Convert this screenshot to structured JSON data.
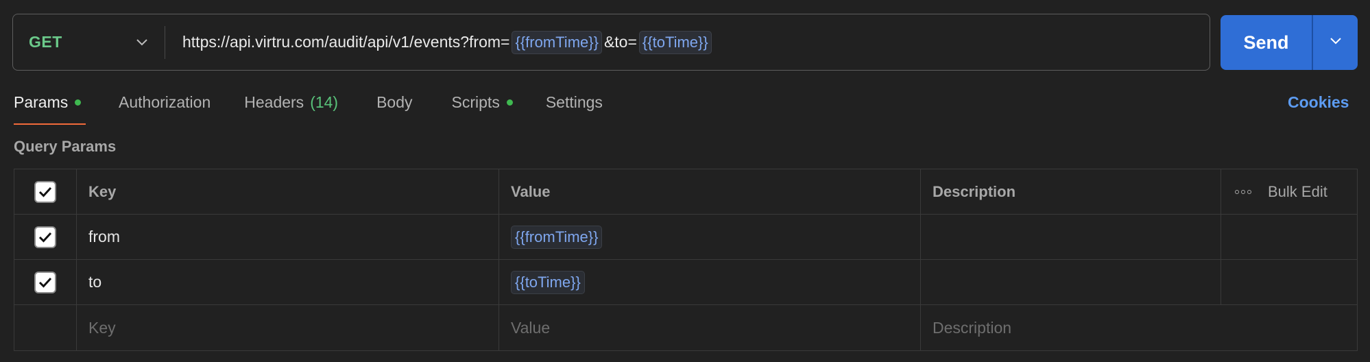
{
  "request": {
    "method": "GET",
    "url_prefix": "https://api.virtru.com/audit/api/v1/events?from=",
    "url_var_from": "{{fromTime}}",
    "url_mid": "&to=",
    "url_var_to": "{{toTime}}"
  },
  "send": {
    "label": "Send"
  },
  "tabs": [
    {
      "label": "Params",
      "active": true,
      "dot": true
    },
    {
      "label": "Authorization"
    },
    {
      "label": "Headers",
      "count": "(14)"
    },
    {
      "label": "Body"
    },
    {
      "label": "Scripts",
      "dot": true
    },
    {
      "label": "Settings"
    }
  ],
  "cookies": "Cookies",
  "section_title": "Query Params",
  "table": {
    "headers": {
      "key": "Key",
      "value": "Value",
      "description": "Description",
      "bulk_edit": "Bulk Edit"
    },
    "rows": [
      {
        "key": "from",
        "value": "{{fromTime}}",
        "checked": true
      },
      {
        "key": "to",
        "value": "{{toTime}}",
        "checked": true
      }
    ],
    "placeholders": {
      "key": "Key",
      "value": "Value",
      "description": "Description"
    }
  },
  "colors": {
    "method": "#6bc98a",
    "variable": "#7fa7ef",
    "send": "#2f6ed6",
    "active_tab_underline": "#f26b3a",
    "dot": "#3fb950",
    "cookies": "#5d9cf2"
  }
}
